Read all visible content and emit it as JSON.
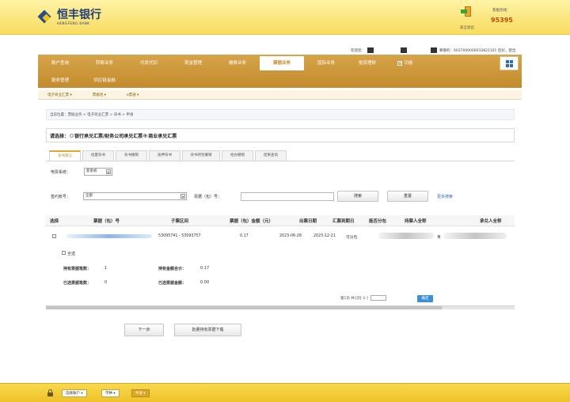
{
  "header": {
    "brand_cn": "恒丰银行",
    "brand_en": "HENGFENG BANK",
    "exit_label": "安全退出",
    "hotline_label": "客服热线：",
    "hotline_number": "95395"
  },
  "userinfo": {
    "label1": "欢迎您：",
    "account_text": "尊敬的：6037000000033821101 您好，登出"
  },
  "mainnav": {
    "row1": [
      "账户查询",
      "转账业务",
      "代发代扣",
      "现金管理",
      "缴费业务",
      "票据业务",
      "国际业务",
      "投资理财",
      "功能"
    ],
    "active_index": 5,
    "row2": [
      "服务管理",
      "供应链金融"
    ]
  },
  "subnav": [
    "电子商业汇票",
    "票据池",
    "e票通"
  ],
  "breadcrumb": "当前位置：票据业务 > 电子商业汇票 > 背书 > 申请",
  "select_bar": {
    "label": "请选择：",
    "option1": "银行承兑汇票/财务公司承兑汇票",
    "option2": "商业承兑汇票"
  },
  "tabs": [
    "背书转让",
    "批量背书",
    "背书撤销",
    "质押背书",
    "背书待签撤销",
    "经办撤销",
    "结果查询"
  ],
  "form": {
    "system_label": "电票系统：",
    "system_value": "新系统",
    "account_label": "签约账号：",
    "account_value": "全部",
    "bill_no_label": "票据（包）号：",
    "search_button": "搜索",
    "reset_button": "重置",
    "more_search": "更多搜索"
  },
  "table": {
    "headers": [
      "选择",
      "票据（包）号",
      "子票区间",
      "票据（包）金额（元）",
      "出票日期",
      "汇票到期日",
      "能否分包",
      "持票人全称",
      "承兑人全称"
    ],
    "row": {
      "sub_range": "53095741 - 53093757",
      "amount": "0.17",
      "issue_date": "2023-06-28",
      "due_date": "2023-12-21",
      "splittable": "可分包",
      "acceptor_suffix": "青"
    }
  },
  "select_all": "全选",
  "summary": {
    "held_count_label": "持有票据笔数：",
    "held_count": "1",
    "held_amount_label": "持有金额合计：",
    "held_amount": "0.17",
    "selected_count_label": "已选票据笔数：",
    "selected_count": "0",
    "selected_amount_label": "已选票据金额：",
    "selected_amount": "0.00"
  },
  "pager": {
    "text": "第1页 共1页[-1-]",
    "go_button": "确定"
  },
  "actions": {
    "next_button": "下一步",
    "batch_download_button": "批量持有票据下载"
  },
  "bottombar": {
    "items": [
      "选择账户",
      "币种",
      "申请"
    ]
  }
}
